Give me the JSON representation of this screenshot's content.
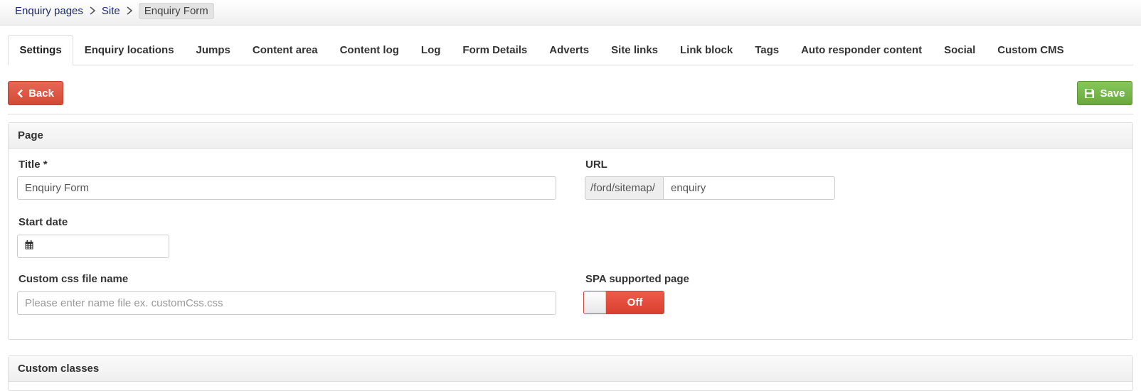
{
  "breadcrumb": {
    "items": [
      "Enquiry pages",
      "Site"
    ],
    "current": "Enquiry Form"
  },
  "tabs": [
    {
      "label": "Settings",
      "active": true
    },
    {
      "label": "Enquiry locations"
    },
    {
      "label": "Jumps"
    },
    {
      "label": "Content area"
    },
    {
      "label": "Content log"
    },
    {
      "label": "Log"
    },
    {
      "label": "Form Details"
    },
    {
      "label": "Adverts"
    },
    {
      "label": "Site links"
    },
    {
      "label": "Link block"
    },
    {
      "label": "Tags"
    },
    {
      "label": "Auto responder content"
    },
    {
      "label": "Social"
    },
    {
      "label": "Custom CMS"
    }
  ],
  "toolbar": {
    "back_label": "Back",
    "save_label": "Save"
  },
  "page_panel": {
    "heading": "Page",
    "title_label": "Title *",
    "title_value": "Enquiry Form",
    "url_label": "URL",
    "url_prefix": "/ford/sitemap/",
    "url_value": "enquiry",
    "start_date_label": "Start date",
    "start_date_value": "",
    "css_label": "Custom css file name",
    "css_placeholder": "Please enter name file ex. customCss.css",
    "spa_label": "SPA supported page",
    "spa_state": "Off"
  },
  "classes_panel": {
    "heading": "Custom classes"
  },
  "colors": {
    "danger": "#d9402f",
    "success": "#6aa83f",
    "breadcrumb_link": "#1c2a6e"
  },
  "icons": {
    "breadcrumb_separator": "chevron-right-icon",
    "back": "chevron-left-icon",
    "save": "floppy-disk-icon",
    "date": "calendar-icon"
  }
}
